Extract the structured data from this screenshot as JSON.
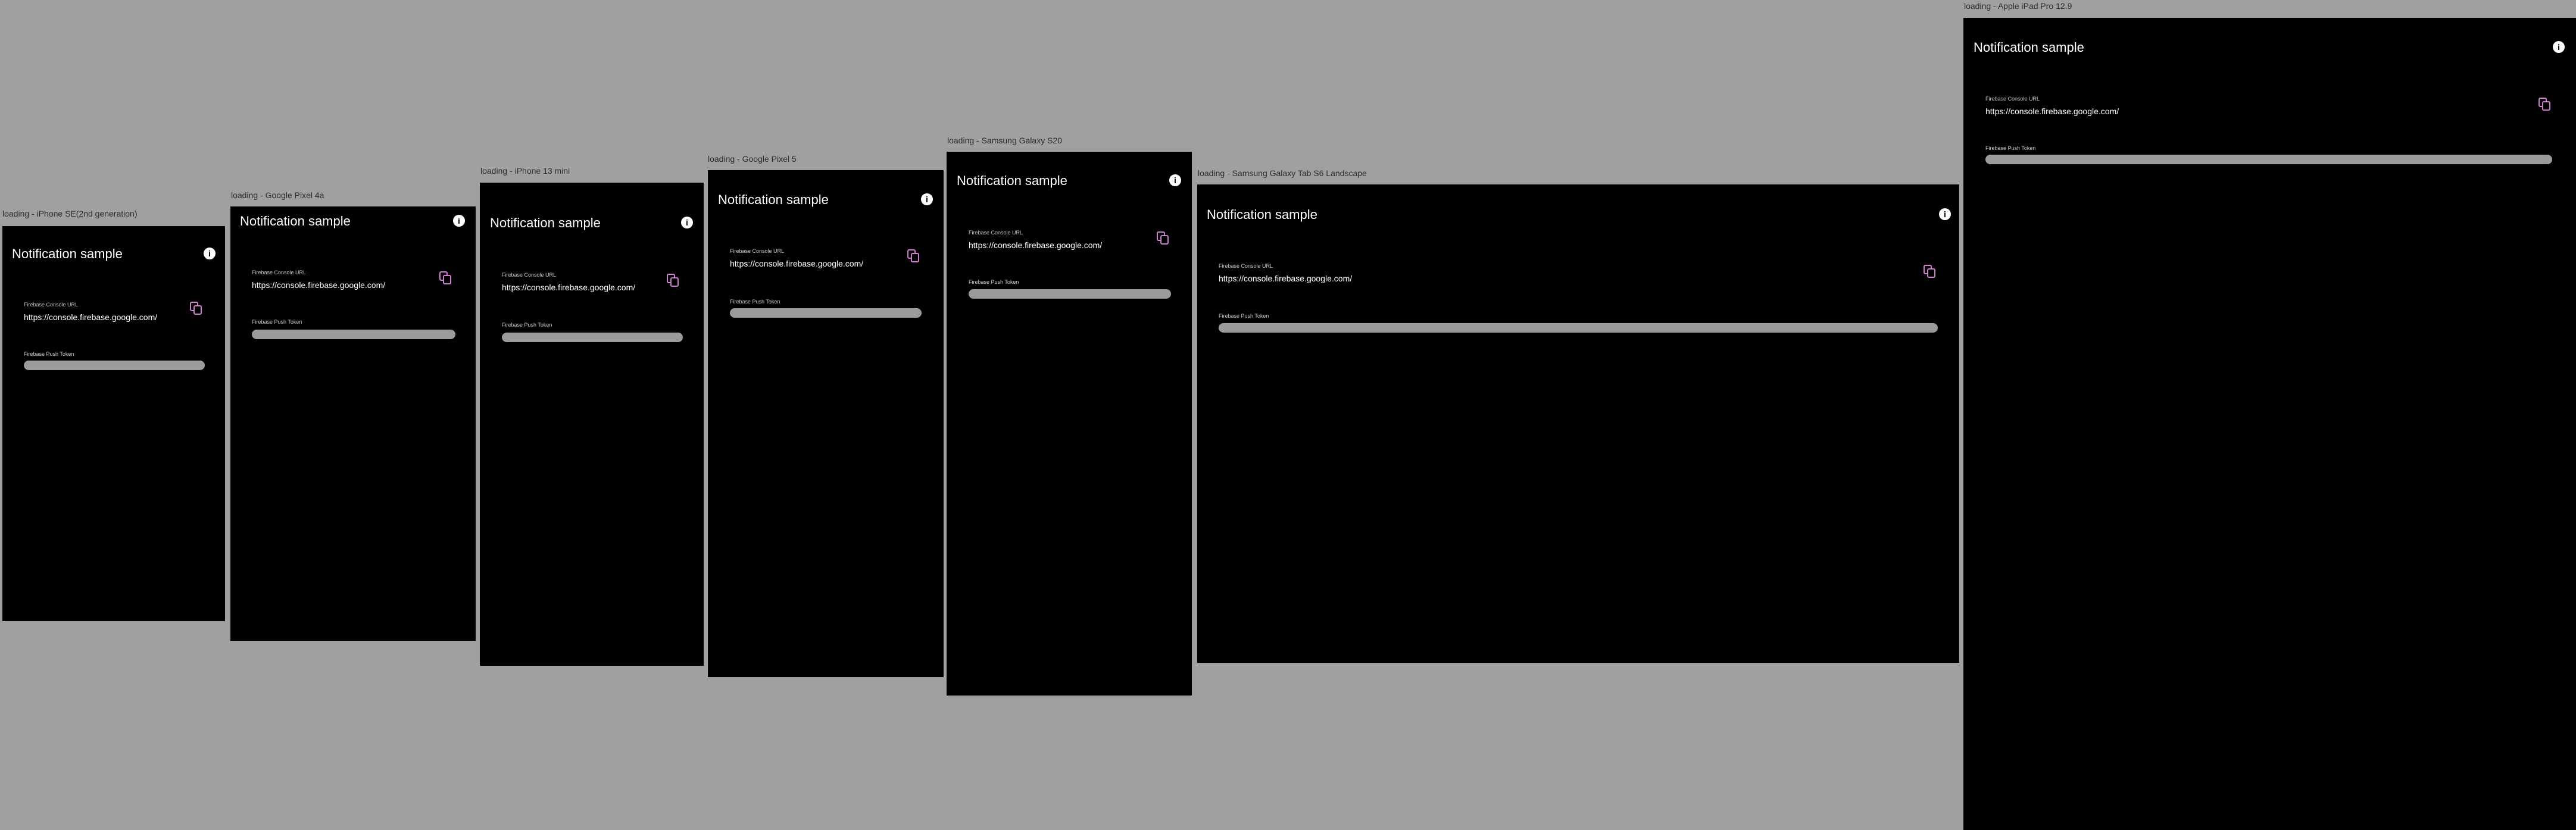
{
  "app": {
    "title": "Notification sample",
    "info_icon": "info-icon",
    "copy_icon": "copy-icon",
    "firebase_console_url_label": "Firebase Console URL",
    "firebase_console_url_value": "https://console.firebase.google.com/",
    "firebase_push_token_label": "Firebase Push Token"
  },
  "devices": [
    {
      "label": "loading - iPhone SE(2nd generation)"
    },
    {
      "label": "loading - Google Pixel 4a"
    },
    {
      "label": "loading - iPhone 13 mini"
    },
    {
      "label": "loading - Google Pixel 5"
    },
    {
      "label": "loading - Samsung Galaxy S20"
    },
    {
      "label": "loading - Samsung Galaxy Tab S6 Landscape"
    },
    {
      "label": "loading - Apple iPad Pro 12.9"
    }
  ],
  "colors": {
    "canvas_background": "#a0a0a0",
    "device_background": "#000000",
    "accent_copy_icon": "#d07fd0",
    "token_placeholder": "#9b9b9b"
  }
}
